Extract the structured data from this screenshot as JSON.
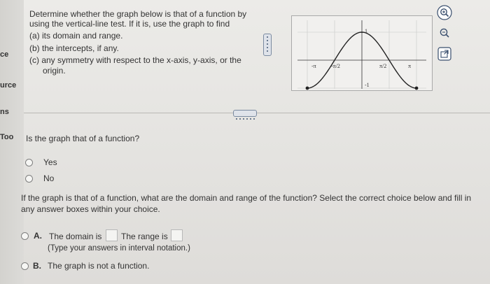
{
  "sidebar": {
    "items": [
      "ce",
      "urce",
      "ns",
      "Too"
    ]
  },
  "question": {
    "line1": "Determine whether the graph below is that of a function by",
    "line2": "using the vertical-line test.  If it is, use the graph to find",
    "parts": [
      "(a) its domain and range.",
      "(b) the intercepts, if any.",
      "(c) any symmetry with respect to the x-axis, y-axis, or the"
    ],
    "part_c_cont": "origin."
  },
  "graph": {
    "tick_neg_pi": "-π",
    "tick_neg_half_pi": "-π/2",
    "tick_half_pi": "π/2",
    "tick_pi": "π",
    "tick_y_pos": "1",
    "tick_y_neg": "-1"
  },
  "tools": {
    "zoom_in": "zoom-in-icon",
    "zoom_out": "zoom-out-icon",
    "popout": "popout-icon"
  },
  "q1": {
    "prompt": "Is the graph that of a function?",
    "options": [
      "Yes",
      "No"
    ]
  },
  "q2": {
    "prompt_line1": "If the graph is that of a function, what are the domain and range of the function? Select the correct choice below and fill in",
    "prompt_line2": "any answer boxes within your choice.",
    "optA_letter": "A.",
    "optA_text1": "The domain is",
    "optA_text2": "The range is",
    "optA_note": "(Type your answers in interval notation.)",
    "optB_letter": "B.",
    "optB_text": "The graph is not a function."
  },
  "chart_data": {
    "type": "line",
    "x": [
      -3.1416,
      -1.5708,
      0,
      1.5708,
      3.1416
    ],
    "values": [
      -1,
      0,
      1,
      0,
      -1
    ],
    "xticks": [
      "-π",
      "-π/2",
      "π/2",
      "π"
    ],
    "yticks": [
      "1",
      "-1"
    ],
    "xlim": [
      -3.1416,
      3.1416
    ],
    "ylim": [
      -1,
      1
    ],
    "endpoints": "closed"
  }
}
